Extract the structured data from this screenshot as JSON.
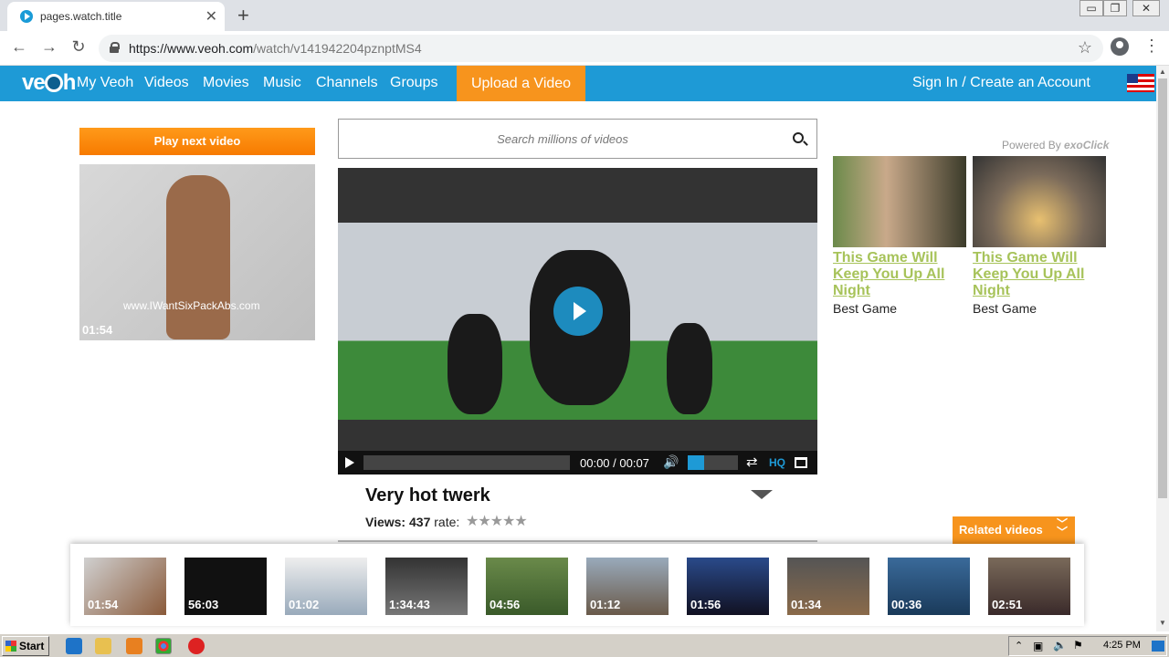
{
  "browser": {
    "tab_title": "pages.watch.title",
    "tab_close": "✕",
    "new_tab": "+",
    "url_host": "https://www.veoh.com",
    "url_path": "/watch/v141942204pznptMS4",
    "window_controls": [
      "▭",
      "❐",
      "✕"
    ]
  },
  "site": {
    "logo_left": "ve",
    "logo_right": "h",
    "nav": [
      "My Veoh",
      "Videos",
      "Movies",
      "Music",
      "Channels",
      "Groups"
    ],
    "upload": "Upload a Video",
    "signin": "Sign In / Create an Account"
  },
  "left": {
    "play_next": "Play next video",
    "thumb_watermark": "www.IWantSixPackAbs.com",
    "thumb_duration": "01:54"
  },
  "search": {
    "placeholder": "Search millions of videos"
  },
  "player": {
    "time": "00:00 / 00:07",
    "hq": "HQ",
    "progress": 0,
    "volume": 0.33
  },
  "video": {
    "title": "Very hot twerk",
    "views_label": "Views:",
    "views": "437",
    "rate_label": "rate:",
    "stars": "★★★★★"
  },
  "ads": {
    "powered_by": "Powered By",
    "brand": "exoClick",
    "items": [
      {
        "headline": "This Game Will Keep You Up All Night",
        "sub": "Best Game"
      },
      {
        "headline": "This Game Will Keep You Up All Night",
        "sub": "Best Game"
      }
    ]
  },
  "related": {
    "label": "Related videos",
    "durations": [
      "01:54",
      "56:03",
      "01:02",
      "1:34:43",
      "04:56",
      "01:12",
      "01:56",
      "01:34",
      "00:36",
      "02:51"
    ]
  },
  "taskbar": {
    "start": "Start",
    "clock": "4:25 PM"
  },
  "colors": {
    "nav_blue": "#1e9ad6",
    "orange": "#f7941d",
    "ad_green": "#a7c35a"
  }
}
